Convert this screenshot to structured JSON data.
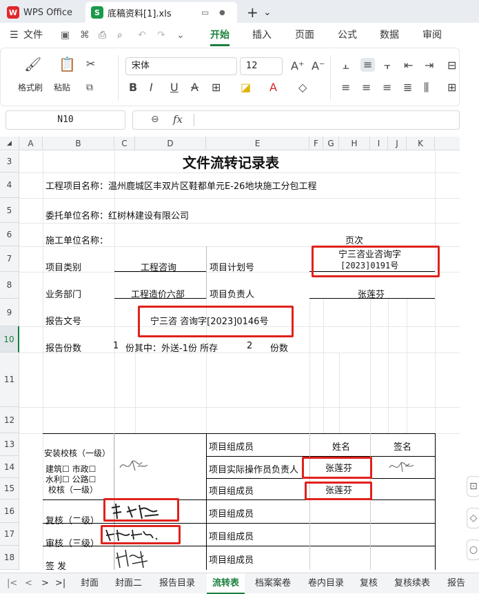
{
  "titlebar": {
    "wps_tab": "WPS Office",
    "file_tab": "底稿资料[1].xls",
    "new_tab": "+",
    "dropdown": "⌄"
  },
  "menu": {
    "file": "文件",
    "items": [
      "开始",
      "插入",
      "页面",
      "公式",
      "数据",
      "审阅"
    ],
    "active": "开始"
  },
  "ribbon": {
    "format_painter": "格式刷",
    "paste": "粘贴",
    "font_name": "宋体",
    "font_size": "12"
  },
  "formula": {
    "cell_ref": "N10",
    "fx": "fx",
    "value": ""
  },
  "columns": [
    "A",
    "B",
    "C",
    "D",
    "E",
    "F",
    "G",
    "H",
    "I",
    "J",
    "K"
  ],
  "rows": [
    "3",
    "4",
    "5",
    "6",
    "7",
    "8",
    "9",
    "10",
    "11",
    "12",
    "13",
    "14",
    "15",
    "16",
    "17",
    "18"
  ],
  "sheet": {
    "title": "文件流转记录表",
    "project_name": "工程项目名称：温州鹿城区丰双片区鞋都单元E-26地块施工分包工程",
    "client": "委托单位名称：红树林建设有限公司",
    "contractor": "施工单位名称：",
    "page_label": "页次",
    "category_label": "项目类别",
    "category_value": "工程咨询",
    "plan_no_label": "项目计划号",
    "plan_no_line1": "宁三咨业咨询字",
    "plan_no_line2": "[2023]0191号",
    "dept_label": "业务部门",
    "dept_value": "工程造价六部",
    "leader_label": "项目负责人",
    "leader_value": "张莲芬",
    "report_no_label": "报告文号",
    "report_no_value": "宁三咨 咨询字[2023]0146号",
    "copies_label": "报告份数",
    "copies_n": "1",
    "copies_mid": "份其中：外送-1份 所存",
    "copies_kept": "2",
    "copies_unit": "份数",
    "check1_label": "安装校核（一级）",
    "check1_types_1": "建筑☐  市政☐",
    "check1_types_2": "水利☐  公路☐",
    "check1_label2": "校核（一级）",
    "review2_label": "复核（二级）",
    "review3_label": "审核（三级）",
    "sign_label": "签  发",
    "member": "项目组成员",
    "operator": "项目实际操作员负责人",
    "name_hdr": "姓名",
    "sign_hdr": "签名",
    "operator_name": "张莲芬",
    "member_name": "张莲芬"
  },
  "sheet_tabs": [
    "封面",
    "封面二",
    "报告目录",
    "流转表",
    "档案案卷",
    "卷内目录",
    "复核",
    "复核续表",
    "报告"
  ],
  "active_sheet": "流转表",
  "colors": {
    "accent": "#1a7f3c",
    "highlight": "#e0211c"
  }
}
